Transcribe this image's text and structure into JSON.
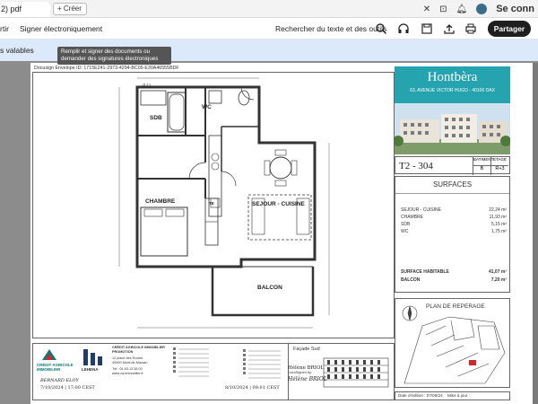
{
  "browser": {
    "tab_label": "2) pdf",
    "new_tab_label": "+ Créer",
    "profile_label": "Se conn"
  },
  "toolbar": {
    "item_partial": "rtir",
    "sign_label": "Signer électroniquement",
    "search_label": "Rechercher du texte et des outils",
    "share_label": "Partager"
  },
  "infobar": {
    "text": "s valables"
  },
  "tooltip": {
    "text": "Remplir et signer des documents ou demander des signatures électroniques"
  },
  "document": {
    "docusign_id": "Docusign Envelope ID: 1715E241-2973-4294-BC05-E30A46555BDF",
    "rooms": {
      "ll": "(LL)",
      "sdb": "SDB",
      "wc": "WC",
      "chambre": "CHAMBRE",
      "sejour": "SEJOUR - CUISINE",
      "balcon": "BALCON",
      "te": "TE"
    },
    "brand": {
      "logo": "Hontbèra",
      "address": "63, AVENUE VICTOR HUGO - 40100 DAX"
    },
    "lot": {
      "number": "T2 - 304",
      "bat_label": "BATIMENT",
      "bat_value": "B",
      "etage_label": "ETAGE",
      "etage_value": "R+3"
    },
    "surfaces": {
      "title": "SURFACES",
      "rows": [
        {
          "label": "SEJOUR - CUISINE",
          "value": "22,24 m²"
        },
        {
          "label": "CHAMBRE",
          "value": "11,93 m²"
        },
        {
          "label": "SDB",
          "value": "5,15 m²"
        },
        {
          "label": "WC",
          "value": "1,75 m²"
        }
      ],
      "habitable_label": "SURFACE HABITABLE",
      "habitable_value": "41,07 m²",
      "balcon_label": "BALCON",
      "balcon_value": "7,20 m²"
    },
    "repere": {
      "title": "PLAN DE REPERAGE"
    },
    "footer": {
      "ca_name": "CRÉDIT AGRICOLE IMMOBILIER",
      "ca_subtitle": "PROMOTION",
      "ca_address_1": "12 place des Ecoles",
      "ca_address_2": "40500 Mont-de-Marsan",
      "ca_phone": "Tél : 01.63.13 38 00",
      "ca_web": "www.ca-immobilier.fr",
      "ca_logo_text": "CRÉDIT AGRICOLE IMMOBILIER",
      "lehena": "LEHENA",
      "facade_title": "Façade Sud",
      "signer_left": "BERNARD ELOY",
      "signer_right": "Hélène BRIOL",
      "signer_right_2": "Hélène BRIOL",
      "docusigned_by": "DocuSigned by:",
      "date_left": "7/10/2024 | 17:00 CEST",
      "date_right": "8/10/2024 | 09:01 CEST",
      "date_edition": "Date d'édition : 07/06/24",
      "mise_a_jour": "Mise à jour :"
    }
  }
}
